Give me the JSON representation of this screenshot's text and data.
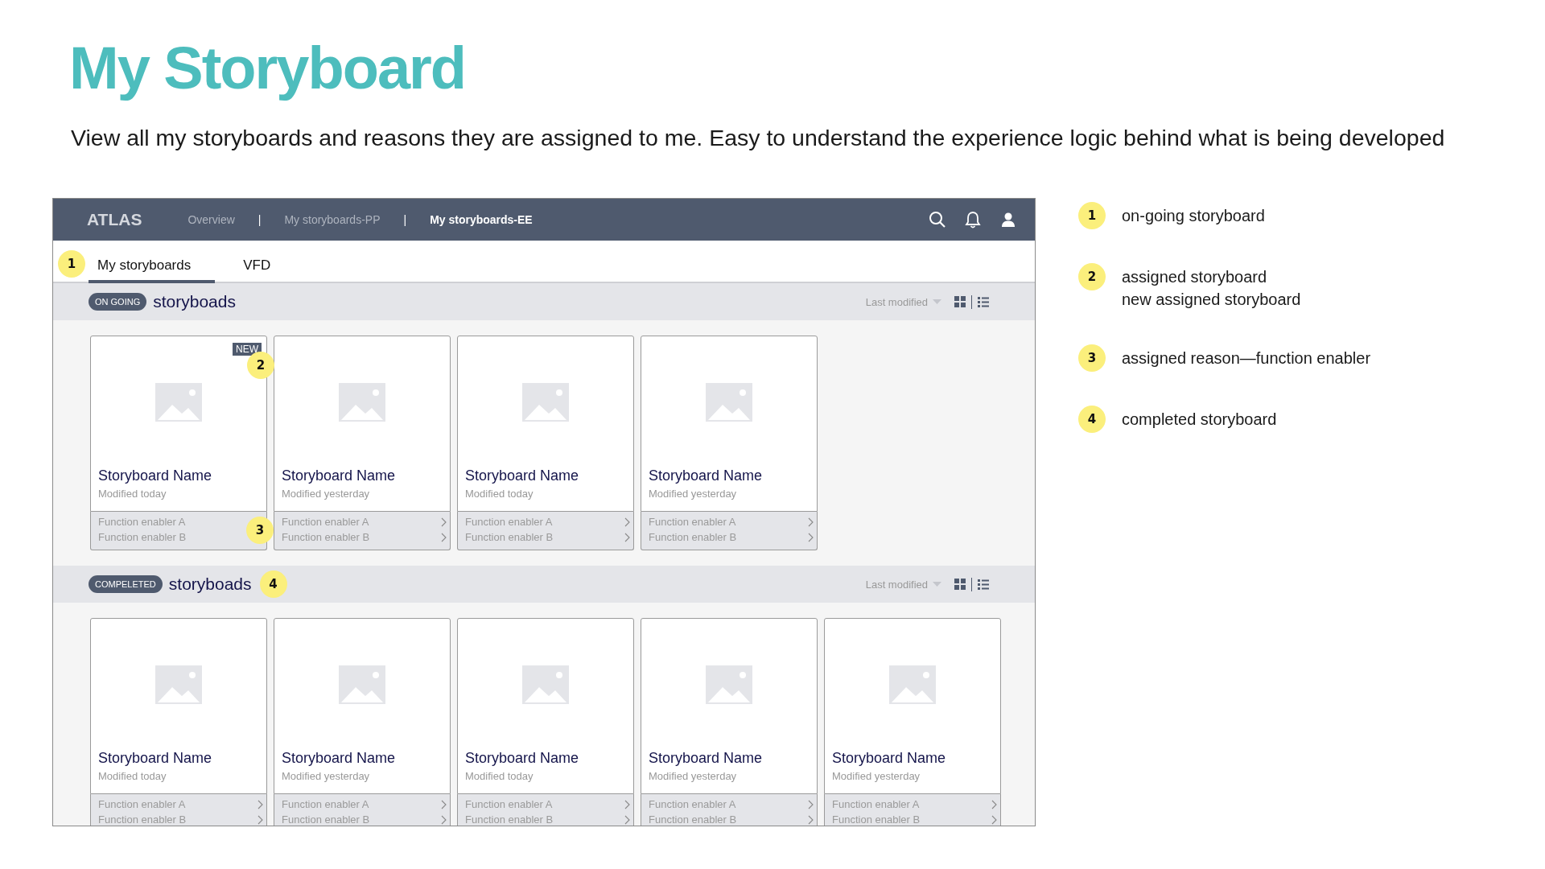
{
  "slide": {
    "title": "My Storyboard",
    "subtitle": "View all my storyboards and reasons they are assigned to me. Easy to understand the experience logic behind what is being developed"
  },
  "app": {
    "logo": "ATLAS",
    "nav": [
      {
        "kind": "link",
        "label": "Overview",
        "selected": false
      },
      {
        "kind": "separator",
        "label": "|"
      },
      {
        "kind": "link",
        "label": "My storyboards-PP",
        "selected": false
      },
      {
        "kind": "separator",
        "label": "|"
      },
      {
        "kind": "link",
        "label": "My storyboards-EE",
        "selected": true
      }
    ],
    "tabs": [
      {
        "label": "My storyboards",
        "selected": true,
        "marker": "1"
      },
      {
        "label": "VFD",
        "selected": false
      }
    ],
    "sections": [
      {
        "badge": "ON GOING",
        "heading": "storyboads",
        "sort": "Last modified",
        "cards": [
          {
            "title": "Storyboard Name",
            "modified": "Modified today",
            "new": true,
            "new_label": "NEW",
            "marker": "2",
            "enabler_marker": "3",
            "enablers": [
              {
                "label": "Function enabler A",
                "arrow": false
              },
              {
                "label": "Function enabler B",
                "arrow": false
              }
            ]
          },
          {
            "title": "Storyboard Name",
            "modified": "Modified yesterday",
            "new": false,
            "enablers": [
              {
                "label": "Function enabler A",
                "arrow": true
              },
              {
                "label": "Function enabler B",
                "arrow": true
              }
            ]
          },
          {
            "title": "Storyboard Name",
            "modified": "Modified today",
            "new": false,
            "enablers": [
              {
                "label": "Function enabler A",
                "arrow": true
              },
              {
                "label": "Function enabler B",
                "arrow": true
              }
            ]
          },
          {
            "title": "Storyboard Name",
            "modified": "Modified yesterday",
            "new": false,
            "enablers": [
              {
                "label": "Function enabler A",
                "arrow": true
              },
              {
                "label": "Function enabler B",
                "arrow": true
              }
            ]
          }
        ]
      },
      {
        "badge": "COMPELETED",
        "heading": "storyboads",
        "marker": "4",
        "sort": "Last modified",
        "cards": [
          {
            "title": "Storyboard Name",
            "modified": "Modified today",
            "new": false,
            "enablers": [
              {
                "label": "Function enabler A",
                "arrow": true
              },
              {
                "label": "Function enabler B",
                "arrow": true
              }
            ]
          },
          {
            "title": "Storyboard Name",
            "modified": "Modified yesterday",
            "new": false,
            "enablers": [
              {
                "label": "Function enabler A",
                "arrow": true
              },
              {
                "label": "Function enabler B",
                "arrow": true
              }
            ]
          },
          {
            "title": "Storyboard Name",
            "modified": "Modified today",
            "new": false,
            "enablers": [
              {
                "label": "Function enabler A",
                "arrow": true
              },
              {
                "label": "Function enabler B",
                "arrow": true
              }
            ]
          },
          {
            "title": "Storyboard Name",
            "modified": "Modified yesterday",
            "new": false,
            "enablers": [
              {
                "label": "Function enabler A",
                "arrow": true
              },
              {
                "label": "Function enabler B",
                "arrow": true
              }
            ]
          },
          {
            "title": "Storyboard Name",
            "modified": "Modified yesterday",
            "new": false,
            "enablers": [
              {
                "label": "Function enabler A",
                "arrow": true
              },
              {
                "label": "Function enabler B",
                "arrow": true
              }
            ]
          }
        ]
      }
    ]
  },
  "legend": [
    {
      "number": "1",
      "lines": [
        "on-going storyboard"
      ]
    },
    {
      "number": "2",
      "lines": [
        "assigned storyboard",
        "new assigned storyboard"
      ]
    },
    {
      "number": "3",
      "lines": [
        "assigned reason—function enabler"
      ]
    },
    {
      "number": "4",
      "lines": [
        "completed storyboard"
      ]
    }
  ]
}
